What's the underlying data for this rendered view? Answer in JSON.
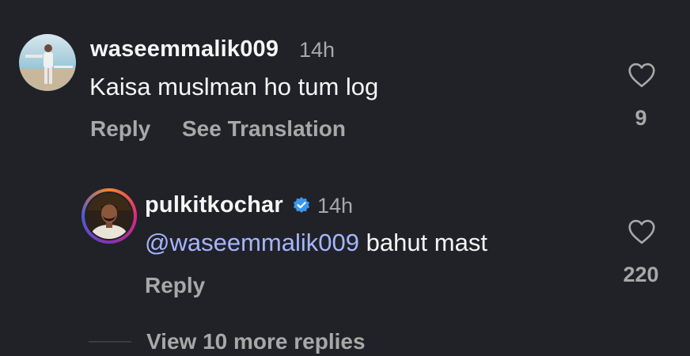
{
  "comments": [
    {
      "username": "waseemmalik009",
      "time": "14h",
      "text": "Kaisa muslman ho tum log",
      "actions": {
        "reply": "Reply",
        "translate": "See Translation"
      },
      "likes": "9",
      "avatar_icon": "avatar-photo",
      "heart_icon": "heart-outline-icon"
    },
    {
      "username": "pulkitkochar",
      "verified": true,
      "time": "14h",
      "mention": "@waseemmalik009",
      "text": "bahut mast",
      "actions": {
        "reply": "Reply"
      },
      "likes": "220",
      "avatar_icon": "avatar-photo",
      "heart_icon": "heart-outline-icon"
    }
  ],
  "view_more": "View 10 more replies",
  "colors": {
    "background": "#202227",
    "primary_text": "#f5f5f5",
    "secondary_text": "#a8a8a8",
    "mention": "#a7b4ff",
    "verified": "#3897f0"
  }
}
